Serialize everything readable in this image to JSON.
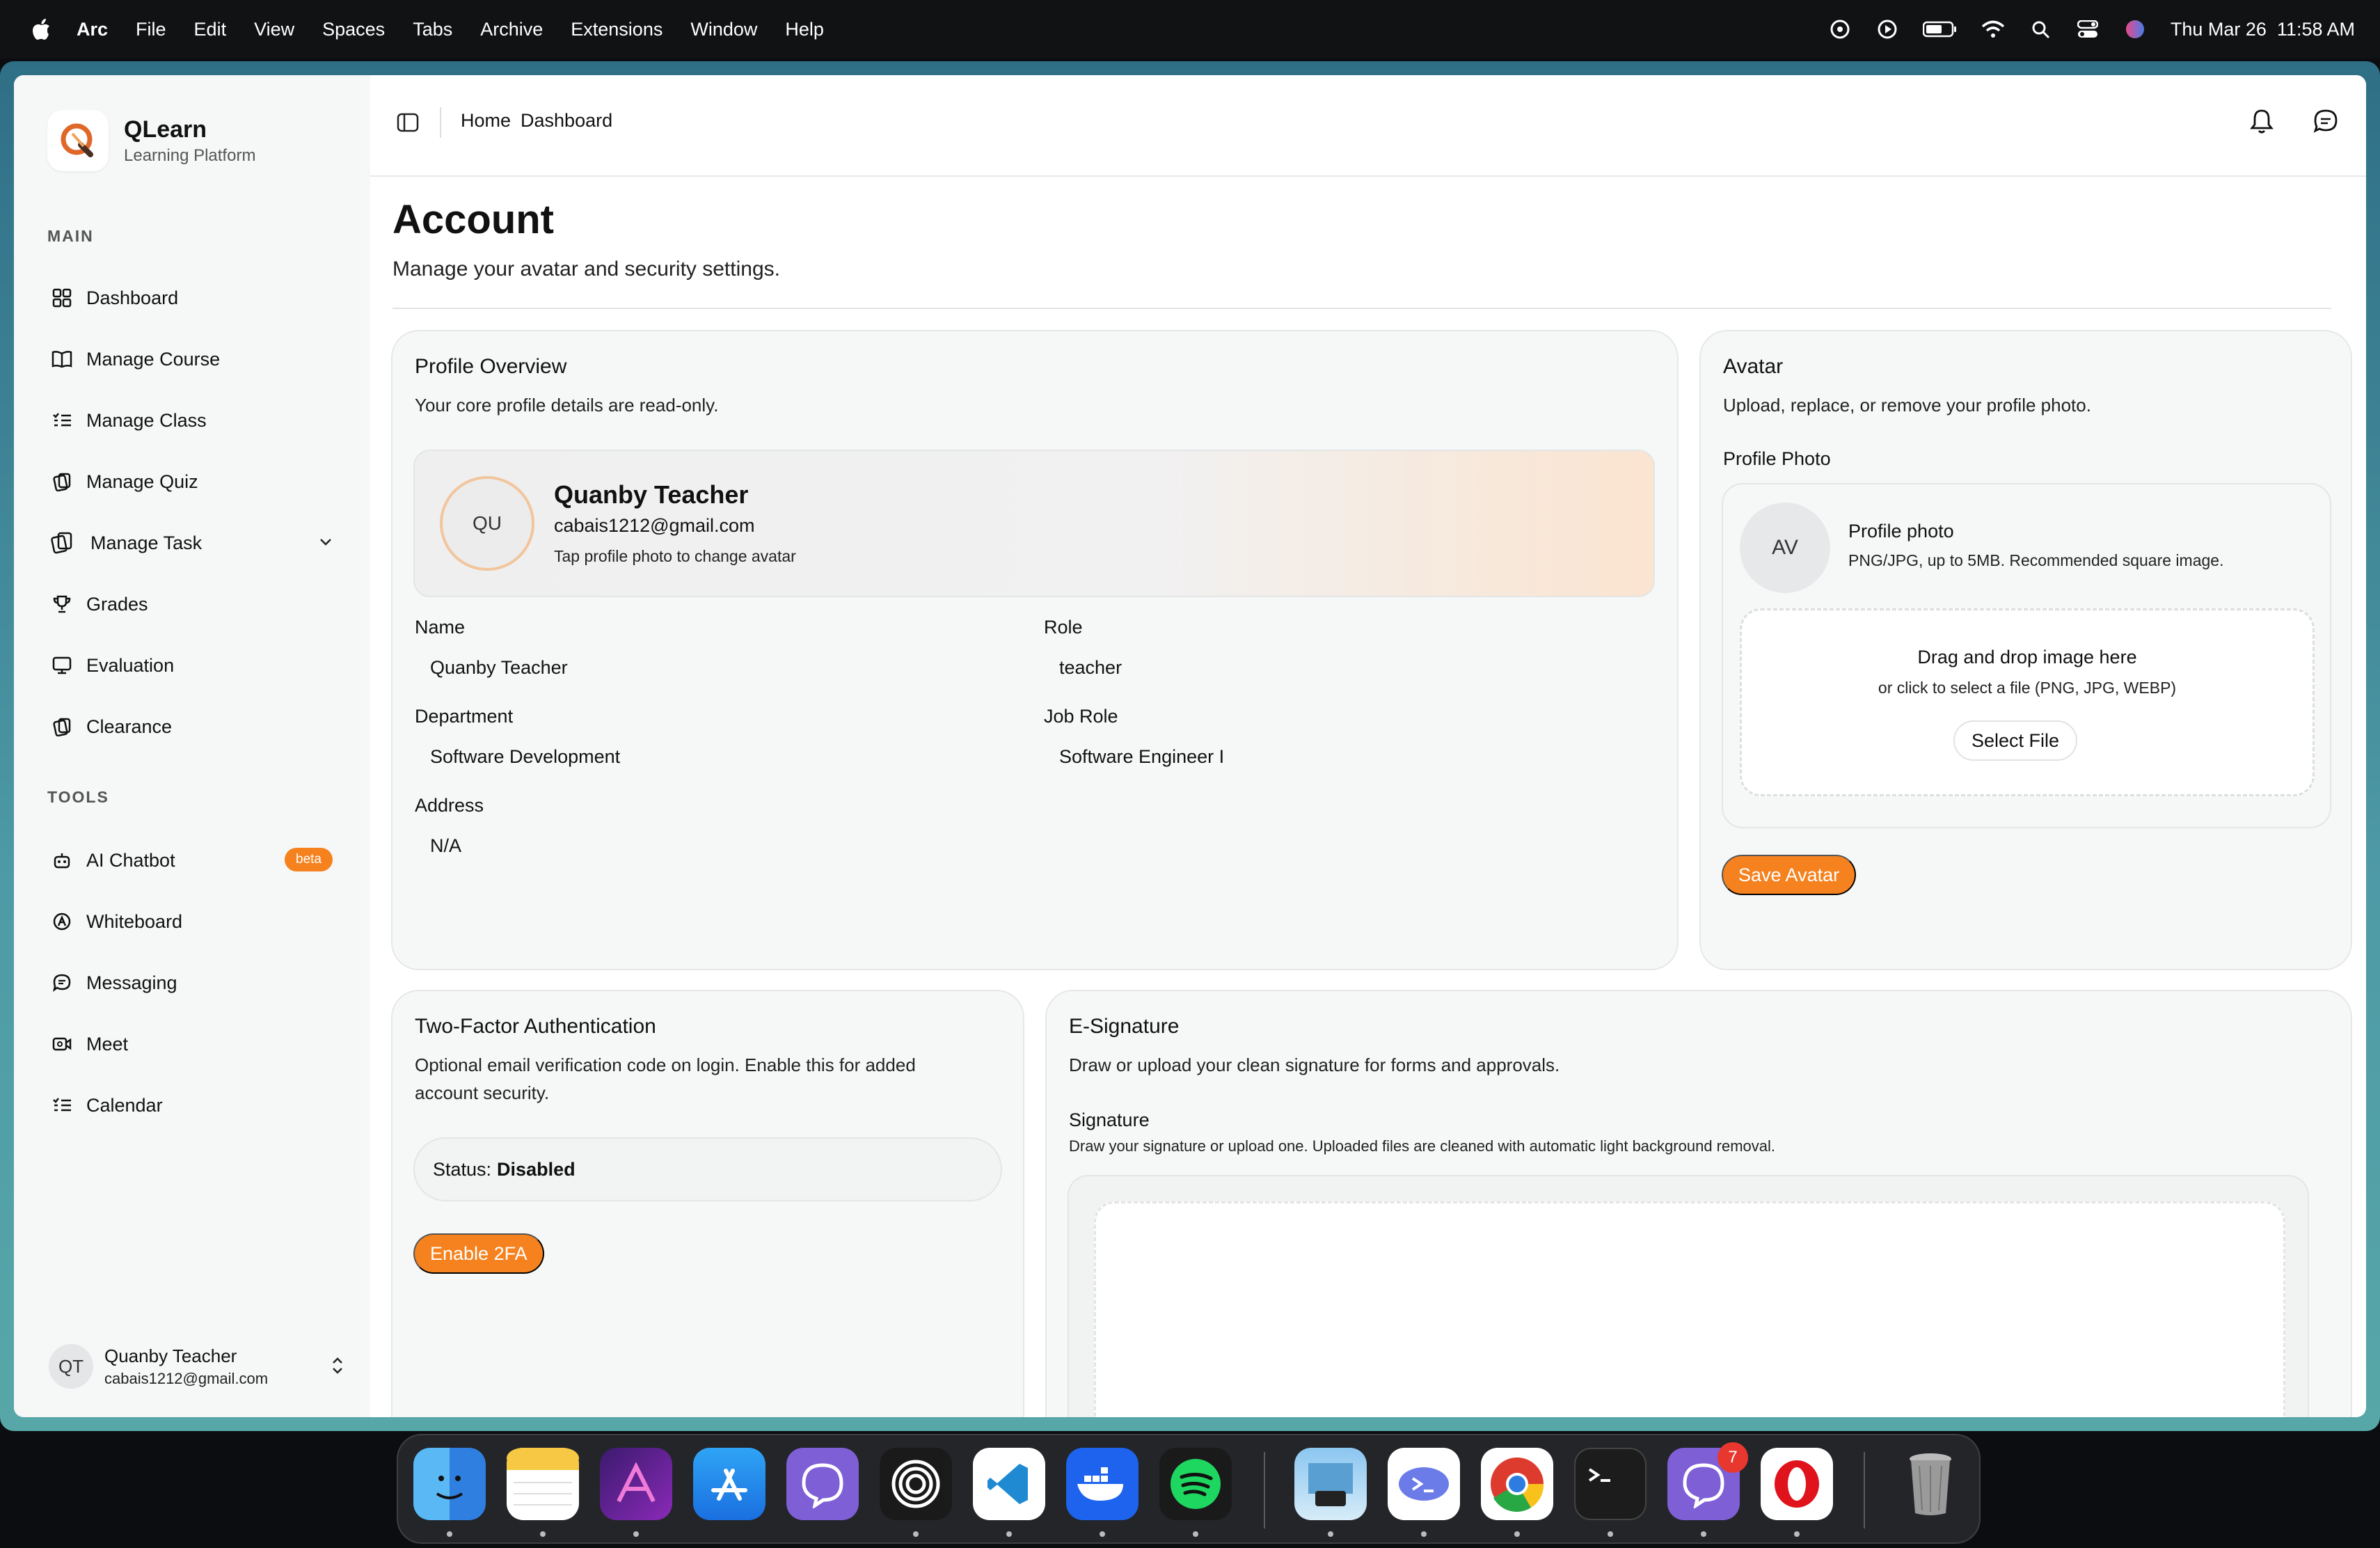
{
  "menubar": {
    "app": "Arc",
    "items": [
      "File",
      "Edit",
      "View",
      "Spaces",
      "Tabs",
      "Archive",
      "Extensions",
      "Window",
      "Help"
    ],
    "datetime": "Thu Mar 26  11:58 AM"
  },
  "sidebar": {
    "brand_name": "QLearn",
    "brand_sub": "Learning Platform",
    "main_label": "MAIN",
    "tools_label": "TOOLS",
    "main_items": [
      {
        "label": "Dashboard",
        "icon": "grid-icon"
      },
      {
        "label": "Manage Course",
        "icon": "book-icon"
      },
      {
        "label": "Manage Class",
        "icon": "list-check-icon"
      },
      {
        "label": "Manage Quiz",
        "icon": "cards-icon"
      },
      {
        "label": "Manage Task",
        "icon": "cards-icon"
      },
      {
        "label": "Grades",
        "icon": "trophy-icon"
      },
      {
        "label": "Evaluation",
        "icon": "monitor-icon"
      },
      {
        "label": "Clearance",
        "icon": "cards-icon"
      }
    ],
    "tool_items": [
      {
        "label": "AI Chatbot",
        "icon": "bot-icon",
        "badge": "beta"
      },
      {
        "label": "Whiteboard",
        "icon": "pen-circle-icon"
      },
      {
        "label": "Messaging",
        "icon": "chat-icon"
      },
      {
        "label": "Meet",
        "icon": "video-icon"
      },
      {
        "label": "Calendar",
        "icon": "list-check-icon"
      }
    ],
    "user": {
      "initials": "QT",
      "name": "Quanby Teacher",
      "email": "cabais1212@gmail.com"
    }
  },
  "topbar": {
    "crumbs": [
      "Home",
      "Dashboard"
    ]
  },
  "page": {
    "title": "Account",
    "subtitle": "Manage your avatar and security settings."
  },
  "profile": {
    "title": "Profile Overview",
    "subtitle": "Your core profile details are read-only.",
    "initials": "QU",
    "name": "Quanby Teacher",
    "email": "cabais1212@gmail.com",
    "hint": "Tap profile photo to change avatar",
    "fields": {
      "name_label": "Name",
      "name_value": "Quanby Teacher",
      "role_label": "Role",
      "role_value": "teacher",
      "dept_label": "Department",
      "dept_value": "Software Development",
      "job_label": "Job Role",
      "job_value": "Software Engineer I",
      "address_label": "Address",
      "address_value": "N/A"
    }
  },
  "avatar": {
    "title": "Avatar",
    "subtitle": "Upload, replace, or remove your profile photo.",
    "photo_label": "Profile Photo",
    "initials": "AV",
    "photo_title": "Profile photo",
    "photo_hint": "PNG/JPG, up to 5MB. Recommended square image.",
    "drop_title": "Drag and drop image here",
    "drop_sub": "or click to select a file (PNG, JPG, WEBP)",
    "select_label": "Select File",
    "save_label": "Save Avatar"
  },
  "twofa": {
    "title": "Two-Factor Authentication",
    "subtitle_line1": "Optional email verification code on login. Enable this for added",
    "subtitle_line2": "account security.",
    "status_label": "Status:",
    "status_value": "Disabled",
    "enable_label": "Enable 2FA"
  },
  "esign": {
    "title": "E-Signature",
    "subtitle": "Draw or upload your clean signature for forms and approvals.",
    "sig_label": "Signature",
    "sig_hint": "Draw your signature or upload one. Uploaded files are cleaned with automatic light background removal."
  },
  "dock": {
    "apps": [
      "finder-icon",
      "notes-icon",
      "affinity-icon",
      "app-store-icon",
      "viber-icon",
      "target-icon",
      "vscode-icon",
      "docker-icon",
      "spotify-icon",
      "preview-icon",
      "powershell-icon",
      "chrome-icon",
      "terminal-icon",
      "viber-icon",
      "opera-icon",
      "trash-icon"
    ],
    "viber_badge": "7"
  },
  "colors": {
    "accent": "#f5821f",
    "frame": "#4e9aa6"
  }
}
